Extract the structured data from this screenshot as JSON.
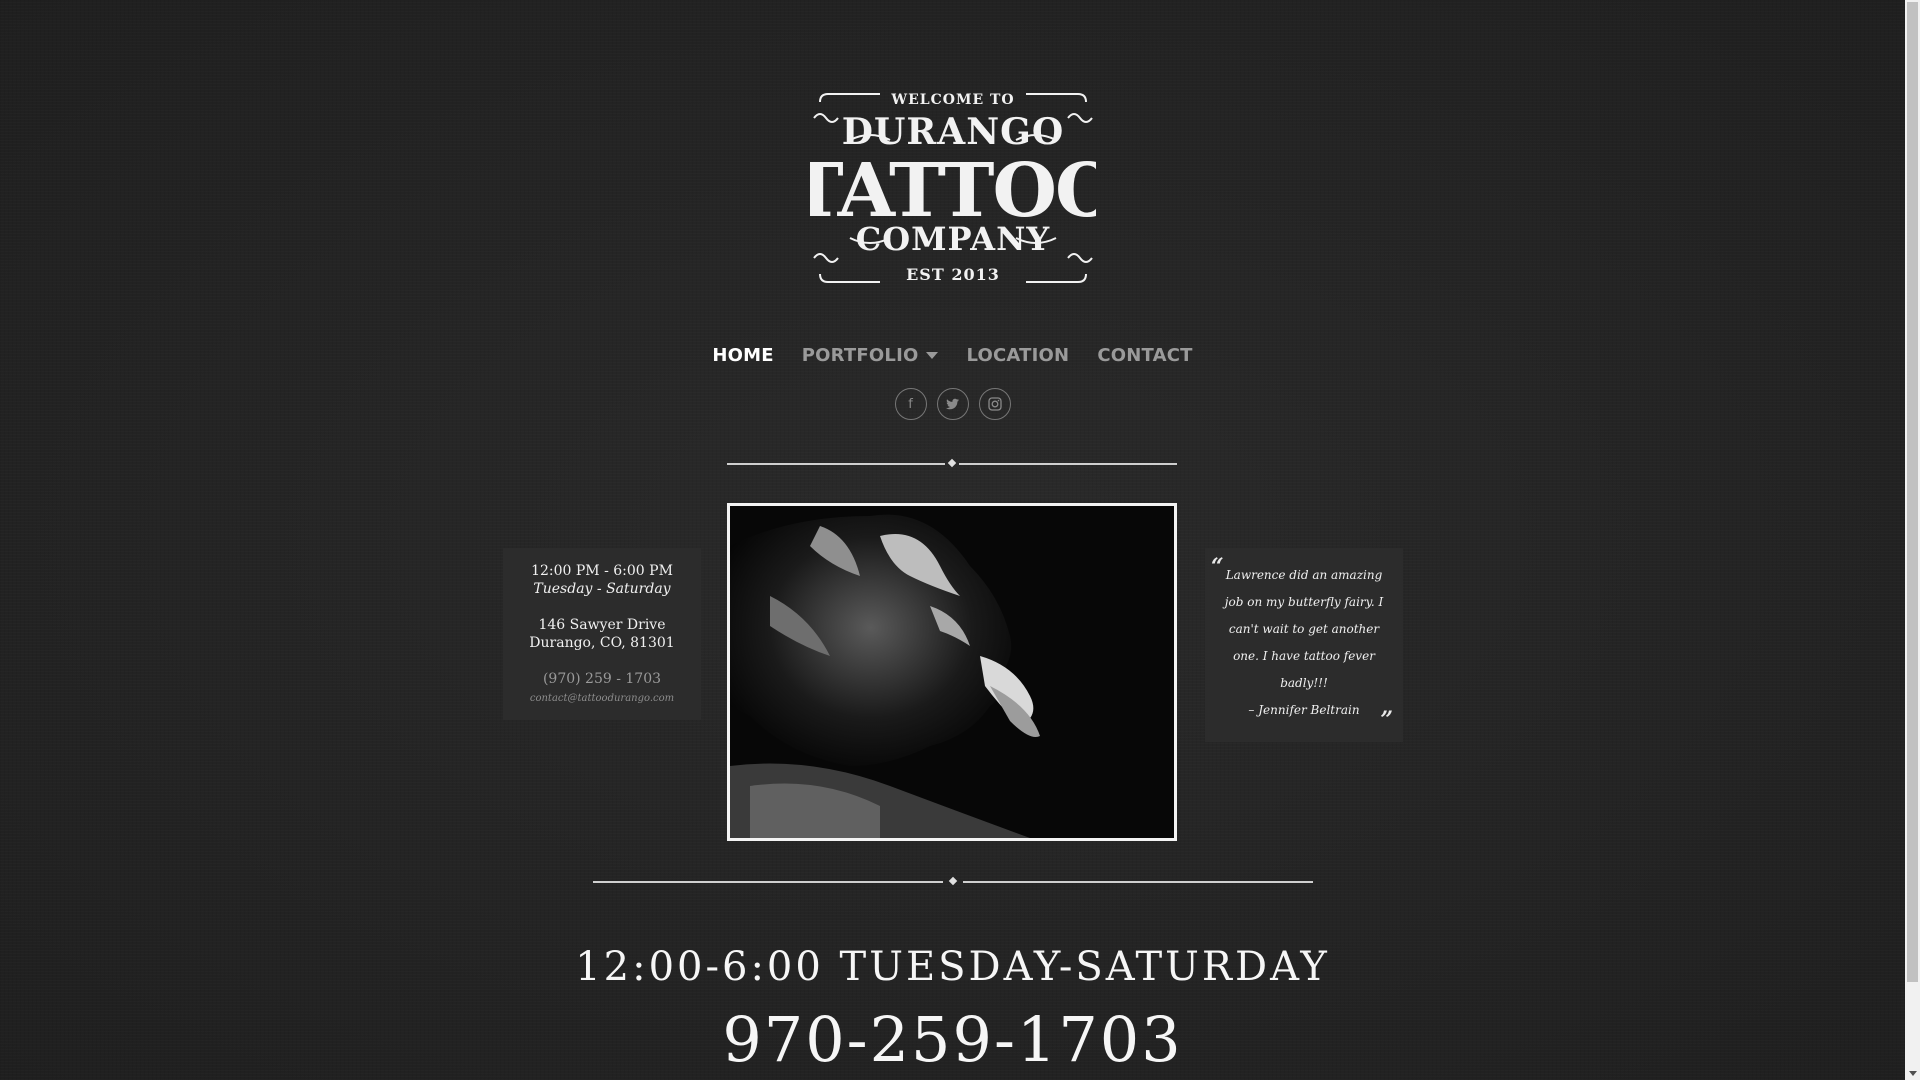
{
  "nav": {
    "items": [
      {
        "label": "HOME",
        "active": true
      },
      {
        "label": "PORTFOLIO",
        "has_dropdown": true
      },
      {
        "label": "LOCATION"
      },
      {
        "label": "CONTACT"
      }
    ]
  },
  "social": [
    {
      "icon": "facebook-icon",
      "glyph": "f"
    },
    {
      "icon": "twitter-icon",
      "glyph": "t"
    },
    {
      "icon": "instagram-icon",
      "glyph": "◎"
    }
  ],
  "logo": {
    "line1": "WELCOME TO",
    "line2": "DURANGO",
    "line3": "TATTOO",
    "line4": "COMPANY",
    "line5": "EST 2013"
  },
  "info": {
    "hours": "12:00 PM - 6:00 PM",
    "days": "Tuesday - Saturday",
    "street": "146 Sawyer Drive",
    "city": "Durango, CO, 81301",
    "phone": "(970) 259 - 1703",
    "email": "contact@tattoodurango.com"
  },
  "testimonial": {
    "text": "Lawrence did an amazing job on my butterfly fairy. I can't wait to get another one. I have tattoo fever badly!!!",
    "author": "– Jennifer Beltrain",
    "open_quote": "“",
    "close_quote": "”"
  },
  "footer": {
    "hours_line": "12:00-6:00   TUESDAY-SATURDAY",
    "phone_line": "970-259-1703"
  },
  "colors": {
    "background": "#232323",
    "panel": "#2c2c2c",
    "text": "#f0f0f0",
    "muted": "#9a9a9a"
  }
}
